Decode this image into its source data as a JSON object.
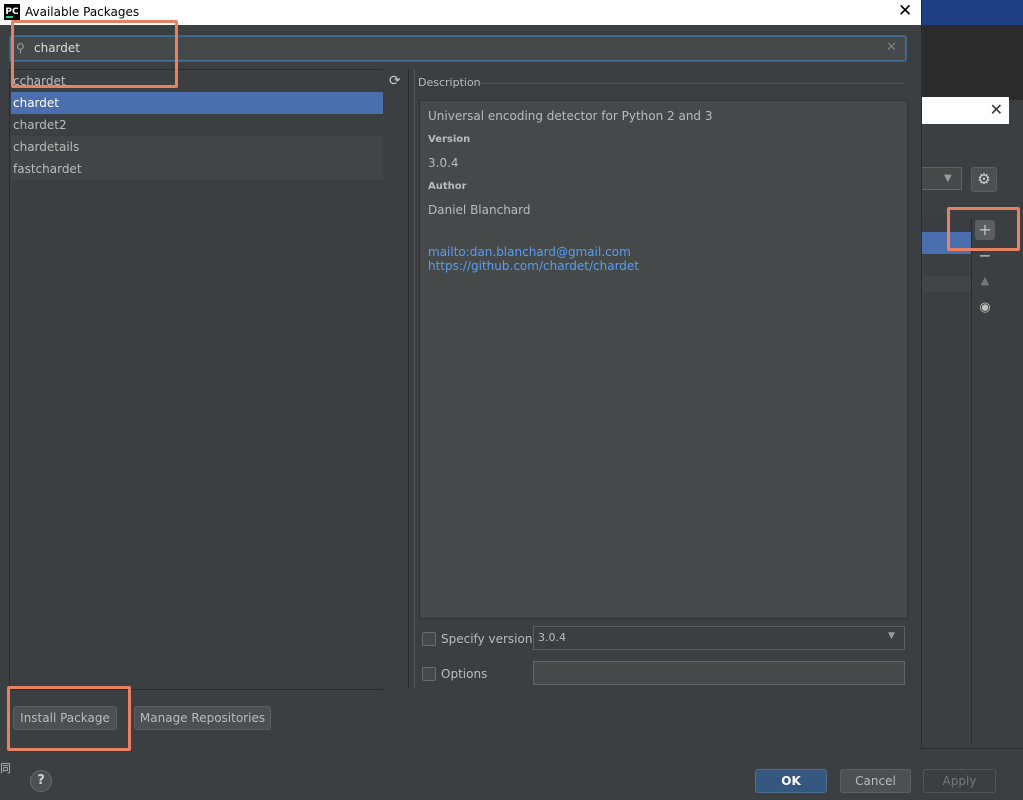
{
  "window": {
    "title": "Available Packages",
    "icon_text": "PC"
  },
  "search": {
    "value": "chardet"
  },
  "packages": [
    {
      "name": "cchardet",
      "selected": false
    },
    {
      "name": "chardet",
      "selected": true
    },
    {
      "name": "chardet2",
      "selected": false
    },
    {
      "name": "chardetails",
      "selected": false
    },
    {
      "name": "fastchardet",
      "selected": false
    }
  ],
  "description": {
    "section_label": "Description",
    "summary": "Universal encoding detector for Python 2 and 3",
    "version_label": "Version",
    "version": "3.0.4",
    "author_label": "Author",
    "author": "Daniel Blanchard",
    "email_link": "mailto:dan.blanchard@gmail.com",
    "url_link": "https://github.com/chardet/chardet"
  },
  "specify_version": {
    "label": "Specify version",
    "value": "3.0.4",
    "checked": false
  },
  "options": {
    "label": "Options",
    "checked": false
  },
  "buttons": {
    "install": "Install Package",
    "manage": "Manage Repositories",
    "ok": "OK",
    "cancel": "Cancel",
    "apply": "Apply",
    "help": "?"
  },
  "background": {
    "cjk_fragment": "同"
  },
  "colors": {
    "selection": "#4b6eaf",
    "link": "#589df6",
    "highlight": "#e68163",
    "ok_button": "#365880"
  }
}
